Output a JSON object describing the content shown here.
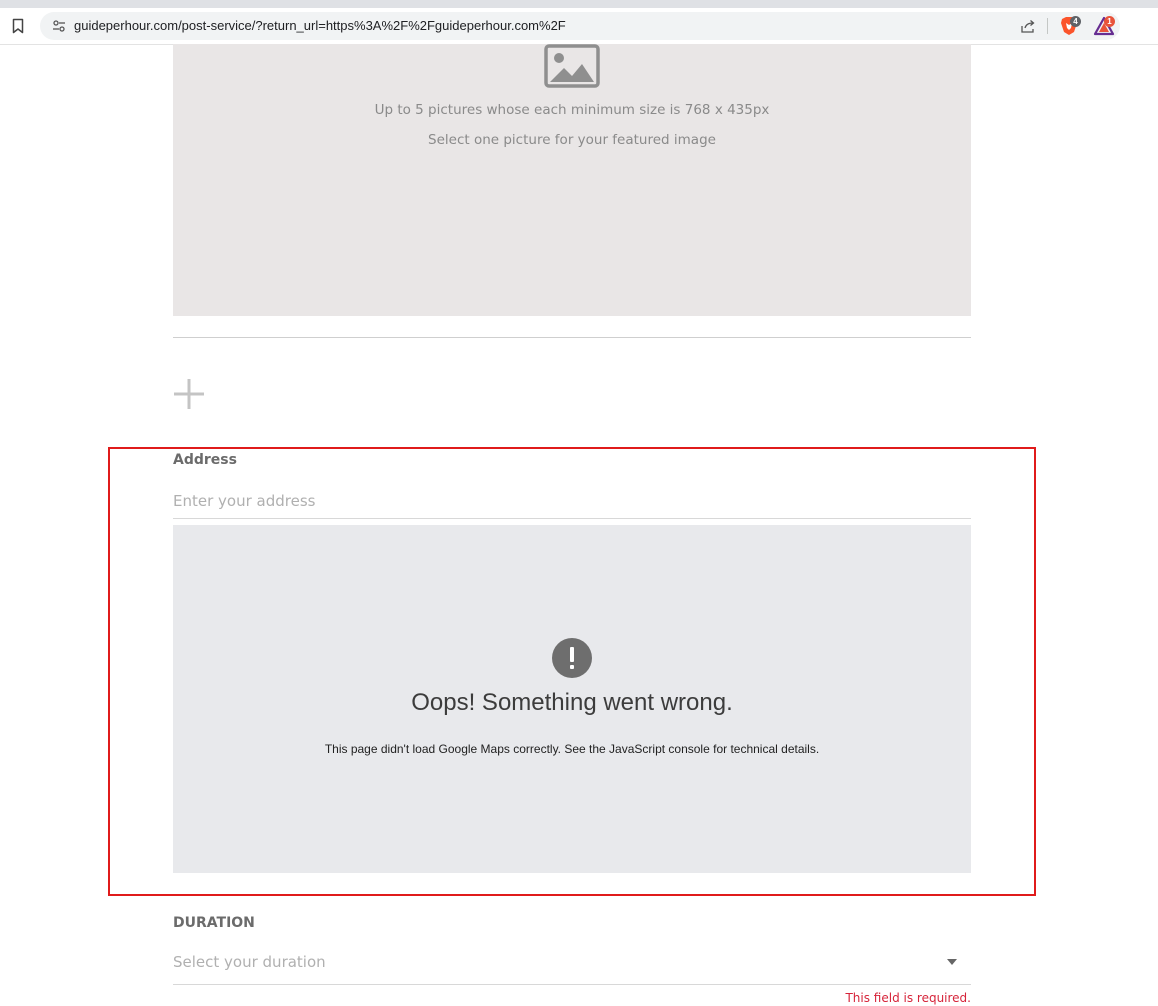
{
  "browser": {
    "url": "guideperhour.com/post-service/?return_url=https%3A%2F%2Fguideperhour.com%2F",
    "brave_badge_count": "4",
    "rewards_badge_count": "1"
  },
  "upload": {
    "hint_size": "Up to 5 pictures whose each minimum size is 768 x 435px",
    "hint_featured": "Select one picture for your featured image"
  },
  "address": {
    "label": "Address",
    "placeholder": "Enter your address",
    "value": ""
  },
  "map_error": {
    "title": "Oops! Something went wrong.",
    "message": "This page didn't load Google Maps correctly. See the JavaScript console for technical details."
  },
  "duration": {
    "label": "DURATION",
    "placeholder": "Select your duration",
    "error": "This field is required."
  },
  "colors": {
    "highlight_border": "#e01b1b",
    "error_text": "#d6243a",
    "map_background": "#e8e9ec",
    "upload_background": "#e9e6e6"
  }
}
